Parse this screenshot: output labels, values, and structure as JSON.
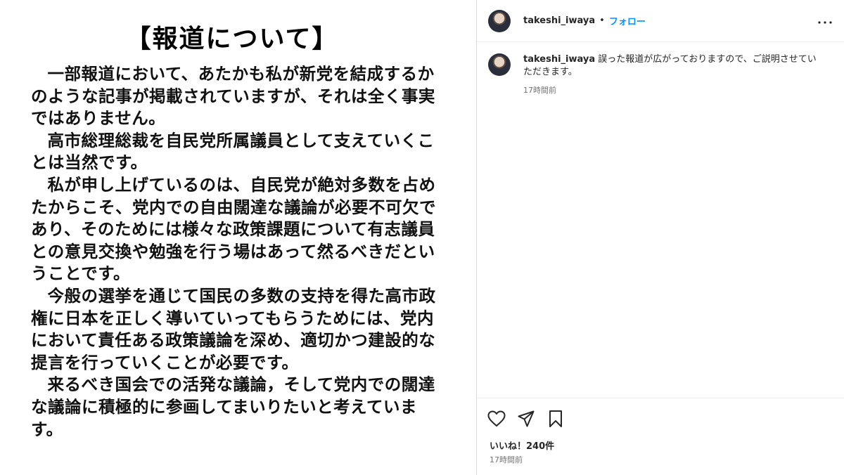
{
  "post_image": {
    "title": "【報道について】",
    "paragraphs": [
      "一部報道において、あたかも私が新党を結成するかのような記事が掲載されていますが、それは全く事実ではありません。",
      "高市総理総裁を自民党所属議員として支えていくことは当然です。",
      "私が申し上げているのは、自民党が絶対多数を占めたからこそ、党内での自由闊達な議論が必要不可欠であり、そのためには様々な政策課題について有志議員との意見交換や勉強を行う場はあって然るべきだということです。",
      "今般の選挙を通じて国民の多数の支持を得た高市政権に日本を正しく導いていってもらうためには、党内において責任ある政策議論を深め、適切かつ建設的な提言を行っていくことが必要です。",
      "来るべき国会での活発な議論，そして党内での闊達な議論に積極的に参画してまいりたいと考えています。"
    ]
  },
  "header": {
    "username": "takeshi_iwaya",
    "separator": "•",
    "follow_label": "フォロー",
    "more_label": "···"
  },
  "caption": {
    "username": "takeshi_iwaya",
    "text": "誤った報道が広がっておりますので、ご説明させていただきます。",
    "time": "17時間前"
  },
  "footer": {
    "likes": "いいね！240件",
    "time": "17時間前"
  },
  "icons": {
    "like": "heart-icon",
    "share": "share-icon",
    "save": "bookmark-icon",
    "more": "more-icon"
  }
}
